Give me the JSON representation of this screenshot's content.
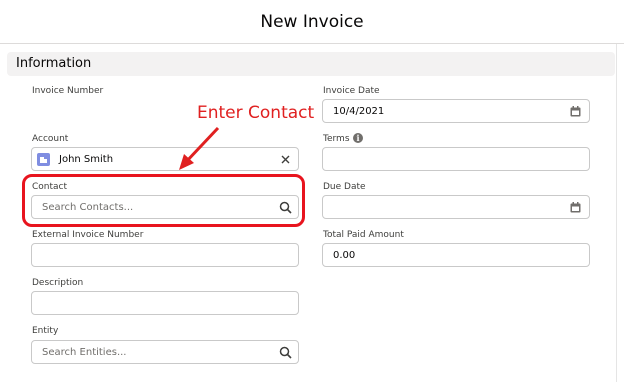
{
  "modal": {
    "title": "New Invoice"
  },
  "section": {
    "title": "Information"
  },
  "left": {
    "invoice_number": {
      "label": "Invoice Number"
    },
    "account": {
      "label": "Account",
      "value": "John Smith"
    },
    "contact": {
      "label": "Contact",
      "placeholder": "Search Contacts..."
    },
    "external_invoice_number": {
      "label": "External Invoice Number",
      "value": ""
    },
    "description": {
      "label": "Description",
      "value": ""
    },
    "entity": {
      "label": "Entity",
      "placeholder": "Search Entities..."
    }
  },
  "right": {
    "invoice_date": {
      "label": "Invoice Date",
      "value": "10/4/2021"
    },
    "terms": {
      "label": "Terms",
      "value": ""
    },
    "due_date": {
      "label": "Due Date",
      "value": ""
    },
    "total_paid_amount": {
      "label": "Total Paid Amount",
      "value": "0.00"
    }
  },
  "annotation": {
    "text": "Enter Contact",
    "color": "#e02020"
  },
  "icons": {
    "calendar": "calendar-icon",
    "search": "search-icon",
    "clear": "close-icon",
    "info": "info-icon",
    "account": "account-icon"
  },
  "colors": {
    "accent_annotation": "#e8141e",
    "account_icon": "#7f8de1"
  }
}
